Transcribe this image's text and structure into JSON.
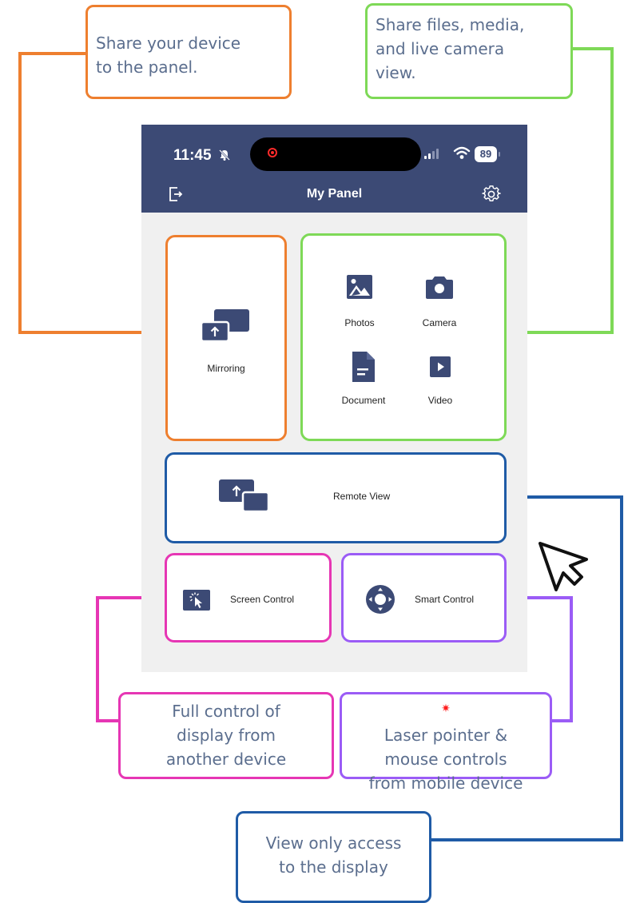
{
  "phone": {
    "status_bar": {
      "time": "11:45",
      "battery": "89"
    },
    "header": {
      "title": "My Panel"
    },
    "tiles": {
      "mirroring": "Mirroring",
      "photos": "Photos",
      "camera": "Camera",
      "document": "Document",
      "video": "Video",
      "remote_view": "Remote View",
      "screen_control": "Screen Control",
      "smart_control": "Smart Control"
    }
  },
  "callouts": {
    "mirroring": [
      "Share your device",
      "to the panel."
    ],
    "share": [
      "Share files, media,",
      "and live camera",
      "view."
    ],
    "screen_control": [
      "Full control of",
      "display from",
      "another device"
    ],
    "smart_control": [
      "Laser pointer &",
      "mouse controls",
      "from mobile device"
    ],
    "remote_view": [
      "View only access",
      "to the display"
    ]
  },
  "colors": {
    "orange": "#ee7f2f",
    "green": "#7ed957",
    "pink": "#e636b4",
    "purple": "#9b5cf6",
    "blue": "#1f5ba6",
    "navy": "#3c4a75"
  }
}
